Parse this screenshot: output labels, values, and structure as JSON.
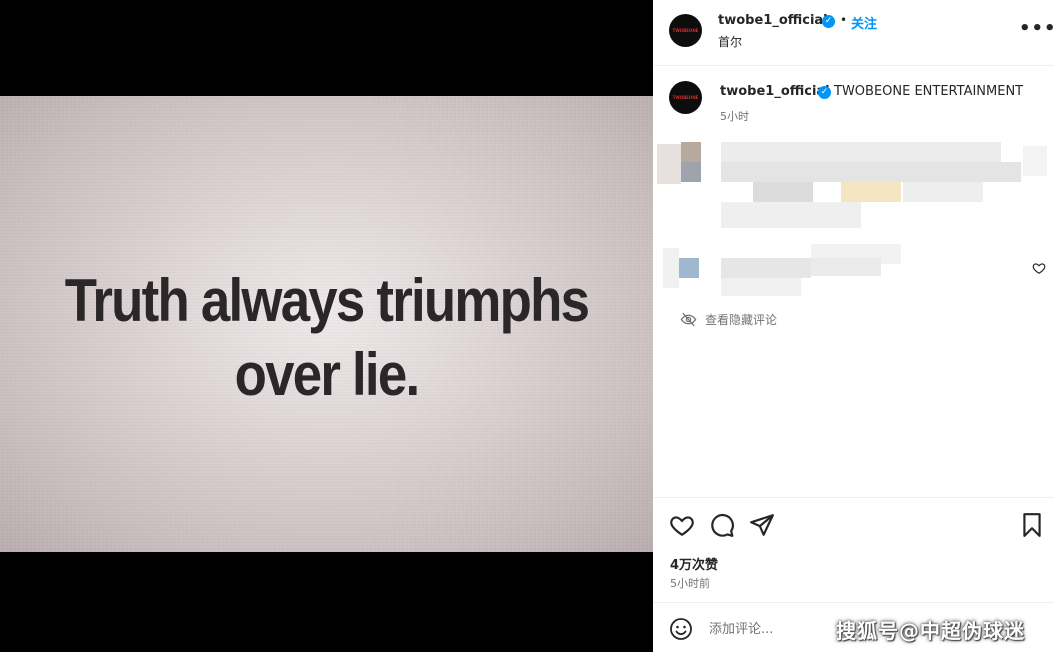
{
  "post": {
    "image_text_line1": "Truth always triumphs",
    "image_text_line2": "over lie."
  },
  "header": {
    "username": "twobe1_official",
    "dot": "•",
    "follow_label": "关注",
    "location": "首尔",
    "more_label": "•••",
    "avatar_logo": "TWOBEONE"
  },
  "caption": {
    "username": "twobe1_official",
    "text": "TWOBEONE ENTERTAINMENT",
    "time": "5小时"
  },
  "comments": {
    "view_hidden_label": "查看隐藏评论"
  },
  "actions": {
    "likes": "4万次赞",
    "posted_time": "5小时前"
  },
  "comment_bar": {
    "placeholder": "添加评论...",
    "watermark": "搜狐号@中超伪球迷"
  },
  "colors": {
    "accent": "#0095f6",
    "muted": "#737373",
    "text": "#262626"
  }
}
